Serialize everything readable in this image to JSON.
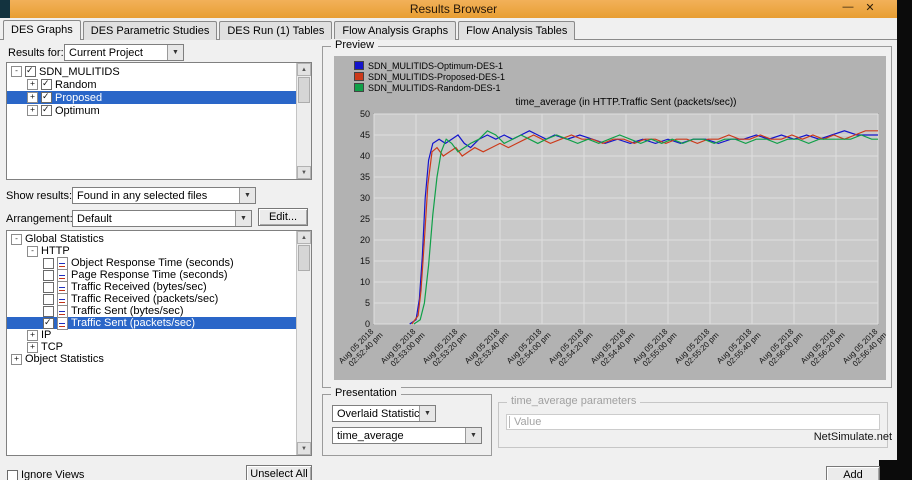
{
  "window": {
    "title": "Results Browser",
    "minimize_glyph": "—",
    "close_glyph": "✕"
  },
  "tabs": [
    {
      "label": "DES Graphs",
      "active": true
    },
    {
      "label": "DES Parametric Studies",
      "active": false
    },
    {
      "label": "DES Run (1) Tables",
      "active": false
    },
    {
      "label": "Flow Analysis Graphs",
      "active": false
    },
    {
      "label": "Flow Analysis Tables",
      "active": false
    }
  ],
  "left": {
    "results_for_label": "Results for:",
    "results_for_value": "Current Project",
    "project_tree": [
      {
        "label": "SDN_MULITIDS",
        "level": 0,
        "expander": "-",
        "checkbox": true,
        "checked": true
      },
      {
        "label": "Random",
        "level": 1,
        "expander": "+",
        "checkbox": true,
        "checked": true
      },
      {
        "label": "Proposed",
        "level": 1,
        "expander": "+",
        "checkbox": true,
        "checked": true,
        "selected": true
      },
      {
        "label": "Optimum",
        "level": 1,
        "expander": "+",
        "checkbox": true,
        "checked": true
      }
    ],
    "show_results_label": "Show results:",
    "show_results_value": "Found in any selected files",
    "arrangement_label": "Arrangement:",
    "arrangement_value": "Default",
    "edit_button": "Edit...",
    "stats_tree": [
      {
        "label": "Global Statistics",
        "level": 0,
        "expander": "-"
      },
      {
        "label": "HTTP",
        "level": 1,
        "expander": "-"
      },
      {
        "label": "Object Response Time (seconds)",
        "level": 2,
        "checkbox": true,
        "checked": false,
        "icon": true
      },
      {
        "label": "Page Response Time (seconds)",
        "level": 2,
        "checkbox": true,
        "checked": false,
        "icon": true
      },
      {
        "label": "Traffic Received (bytes/sec)",
        "level": 2,
        "checkbox": true,
        "checked": false,
        "icon": true
      },
      {
        "label": "Traffic Received (packets/sec)",
        "level": 2,
        "checkbox": true,
        "checked": false,
        "icon": true
      },
      {
        "label": "Traffic Sent (bytes/sec)",
        "level": 2,
        "checkbox": true,
        "checked": false,
        "icon": true
      },
      {
        "label": "Traffic Sent (packets/sec)",
        "level": 2,
        "checkbox": true,
        "checked": true,
        "icon": true,
        "selected": true
      },
      {
        "label": "IP",
        "level": 1,
        "expander": "+"
      },
      {
        "label": "TCP",
        "level": 1,
        "expander": "+"
      },
      {
        "label": "Object Statistics",
        "level": 0,
        "expander": "+"
      }
    ],
    "ignore_views_label": "Ignore Views",
    "unselect_all_button": "Unselect All"
  },
  "preview": {
    "title": "Preview"
  },
  "presentation": {
    "title": "Presentation",
    "overlaid_value": "Overlaid Statistics",
    "metric_value": "time_average"
  },
  "parameters": {
    "title": "time_average parameters",
    "value_label": "Value"
  },
  "footer": {
    "watermark": "NetSimulate.net",
    "add_button": "Add"
  },
  "chart_data": {
    "type": "line",
    "title": "time_average (in HTTP.Traffic Sent (packets/sec))",
    "xlabel": "",
    "ylabel": "",
    "ylim": [
      0,
      50
    ],
    "ytick_step": 5,
    "xlim": [
      0,
      12
    ],
    "grid": true,
    "legend_position": "top-left",
    "xtick_date": "Aug 05 2018",
    "xtick_times": [
      "02:52:40 pm",
      "02:53:00 pm",
      "02:53:20 pm",
      "02:53:40 pm",
      "02:54:00 pm",
      "02:54:20 pm",
      "02:54:40 pm",
      "02:55:00 pm",
      "02:55:20 pm",
      "02:55:40 pm",
      "02:56:00 pm",
      "02:56:20 pm",
      "02:56:40 pm"
    ],
    "series": [
      {
        "name": "SDN_MULITIDS-Optimum-DES-1",
        "color": "#1414cc",
        "points": [
          [
            0.85,
            0
          ],
          [
            1.0,
            1
          ],
          [
            1.08,
            6
          ],
          [
            1.15,
            16
          ],
          [
            1.22,
            30
          ],
          [
            1.3,
            39
          ],
          [
            1.4,
            43
          ],
          [
            1.55,
            44
          ],
          [
            1.7,
            43
          ],
          [
            1.85,
            44
          ],
          [
            2.0,
            45
          ],
          [
            2.15,
            43
          ],
          [
            2.3,
            42
          ],
          [
            2.5,
            44
          ],
          [
            2.7,
            45
          ],
          [
            2.9,
            44
          ],
          [
            3.1,
            45
          ],
          [
            3.3,
            44
          ],
          [
            3.5,
            45
          ],
          [
            3.7,
            46
          ],
          [
            3.9,
            45
          ],
          [
            4.1,
            44
          ],
          [
            4.3,
            45
          ],
          [
            4.6,
            44
          ],
          [
            4.9,
            45
          ],
          [
            5.2,
            44
          ],
          [
            5.5,
            43
          ],
          [
            5.8,
            44
          ],
          [
            6.1,
            43
          ],
          [
            6.4,
            44
          ],
          [
            6.7,
            43
          ],
          [
            7.0,
            44
          ],
          [
            7.3,
            43
          ],
          [
            7.6,
            44
          ],
          [
            7.9,
            44
          ],
          [
            8.2,
            43
          ],
          [
            8.5,
            44
          ],
          [
            8.8,
            44
          ],
          [
            9.1,
            45
          ],
          [
            9.4,
            44
          ],
          [
            9.7,
            45
          ],
          [
            10.0,
            44
          ],
          [
            10.3,
            45
          ],
          [
            10.6,
            44
          ],
          [
            10.9,
            45
          ],
          [
            11.2,
            46
          ],
          [
            11.5,
            45
          ],
          [
            11.8,
            45
          ],
          [
            12.0,
            45
          ]
        ]
      },
      {
        "name": "SDN_MULITIDS-Proposed-DES-1",
        "color": "#cc3a1a",
        "points": [
          [
            0.9,
            0
          ],
          [
            1.05,
            2
          ],
          [
            1.12,
            8
          ],
          [
            1.2,
            20
          ],
          [
            1.28,
            33
          ],
          [
            1.38,
            41
          ],
          [
            1.5,
            42
          ],
          [
            1.65,
            40
          ],
          [
            1.8,
            41
          ],
          [
            1.95,
            42
          ],
          [
            2.1,
            40
          ],
          [
            2.25,
            41
          ],
          [
            2.4,
            42
          ],
          [
            2.6,
            41
          ],
          [
            2.8,
            42
          ],
          [
            3.0,
            43
          ],
          [
            3.2,
            42
          ],
          [
            3.4,
            43
          ],
          [
            3.6,
            44
          ],
          [
            3.8,
            45
          ],
          [
            4.0,
            44
          ],
          [
            4.2,
            43
          ],
          [
            4.45,
            44
          ],
          [
            4.7,
            45
          ],
          [
            4.95,
            44
          ],
          [
            5.2,
            44
          ],
          [
            5.45,
            43
          ],
          [
            5.7,
            44
          ],
          [
            5.95,
            44
          ],
          [
            6.2,
            43
          ],
          [
            6.45,
            44
          ],
          [
            6.7,
            44
          ],
          [
            6.95,
            43
          ],
          [
            7.2,
            44
          ],
          [
            7.45,
            44
          ],
          [
            7.7,
            43
          ],
          [
            7.95,
            44
          ],
          [
            8.2,
            44
          ],
          [
            8.45,
            45
          ],
          [
            8.7,
            44
          ],
          [
            8.95,
            44
          ],
          [
            9.2,
            45
          ],
          [
            9.45,
            44
          ],
          [
            9.7,
            44
          ],
          [
            9.95,
            45
          ],
          [
            10.2,
            44
          ],
          [
            10.45,
            45
          ],
          [
            10.7,
            44
          ],
          [
            10.95,
            45
          ],
          [
            11.2,
            44
          ],
          [
            11.45,
            45
          ],
          [
            11.7,
            46
          ],
          [
            12.0,
            46
          ]
        ]
      },
      {
        "name": "SDN_MULITIDS-Random-DES-1",
        "color": "#10a048",
        "points": [
          [
            0.95,
            0
          ],
          [
            1.1,
            1
          ],
          [
            1.2,
            5
          ],
          [
            1.3,
            14
          ],
          [
            1.4,
            26
          ],
          [
            1.5,
            35
          ],
          [
            1.6,
            41
          ],
          [
            1.72,
            44
          ],
          [
            1.85,
            43
          ],
          [
            2.0,
            41
          ],
          [
            2.15,
            42
          ],
          [
            2.3,
            43
          ],
          [
            2.5,
            44
          ],
          [
            2.7,
            46
          ],
          [
            2.9,
            45
          ],
          [
            3.1,
            43
          ],
          [
            3.3,
            44
          ],
          [
            3.5,
            45
          ],
          [
            3.7,
            44
          ],
          [
            3.9,
            43
          ],
          [
            4.1,
            44
          ],
          [
            4.35,
            45
          ],
          [
            4.6,
            44
          ],
          [
            4.85,
            43
          ],
          [
            5.1,
            44
          ],
          [
            5.35,
            43
          ],
          [
            5.6,
            44
          ],
          [
            5.85,
            45
          ],
          [
            6.1,
            44
          ],
          [
            6.35,
            43
          ],
          [
            6.6,
            44
          ],
          [
            6.85,
            43
          ],
          [
            7.1,
            44
          ],
          [
            7.35,
            43
          ],
          [
            7.6,
            44
          ],
          [
            7.85,
            44
          ],
          [
            8.1,
            43
          ],
          [
            8.35,
            44
          ],
          [
            8.6,
            44
          ],
          [
            8.85,
            43
          ],
          [
            9.1,
            44
          ],
          [
            9.35,
            44
          ],
          [
            9.6,
            43
          ],
          [
            9.85,
            44
          ],
          [
            10.1,
            44
          ],
          [
            10.35,
            43
          ],
          [
            10.6,
            44
          ],
          [
            10.85,
            44
          ],
          [
            11.1,
            44
          ],
          [
            11.35,
            44
          ],
          [
            11.6,
            45
          ],
          [
            11.85,
            44
          ],
          [
            12.0,
            44
          ]
        ]
      }
    ]
  }
}
